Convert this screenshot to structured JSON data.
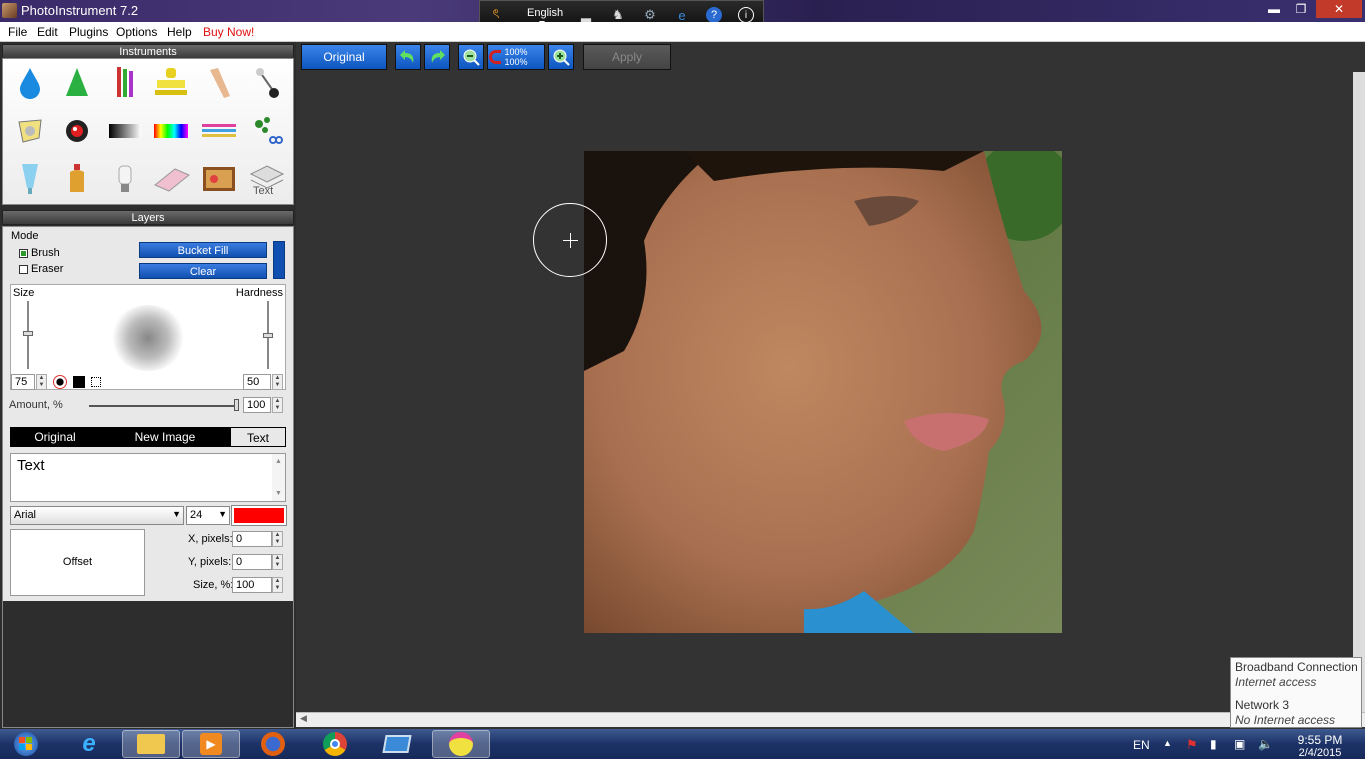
{
  "window": {
    "title": "PhotoInstrument 7.2"
  },
  "topstrip": {
    "language": "English"
  },
  "window_controls": {
    "minimize": "▬",
    "restore": "❐",
    "close": "✕"
  },
  "menu": {
    "file": "File",
    "edit": "Edit",
    "plugins": "Plugins",
    "options": "Options",
    "help": "Help",
    "buy": "Buy Now!"
  },
  "instruments": {
    "title": "Instruments"
  },
  "layers": {
    "title": "Layers",
    "mode_label": "Mode",
    "brush_label": "Brush",
    "eraser_label": "Eraser",
    "bucket_fill": "Bucket Fill",
    "clear": "Clear",
    "size_label": "Size",
    "hardness_label": "Hardness",
    "size_value": "75",
    "hardness_value": "50",
    "amount_label": "Amount, %",
    "amount_value": "100",
    "tabs": {
      "original": "Original",
      "new_image": "New Image",
      "text": "Text"
    },
    "text_value": "Text",
    "font_value": "Arial",
    "font_size_value": "24",
    "text_color": "#ff0000",
    "offset_label": "Offset",
    "x_label": "X, pixels:",
    "x_value": "0",
    "y_label": "Y, pixels:",
    "y_value": "0",
    "sizepct_label": "Size, %:",
    "sizepct_value": "100"
  },
  "toolbar": {
    "original": "Original",
    "zoom_100_top": "100%",
    "zoom_100_bottom": "100%",
    "apply": "Apply"
  },
  "tooltip": {
    "conn1_name": "Broadband Connection",
    "conn1_status": "Internet access",
    "conn2_name": "Network  3",
    "conn2_status": "No Internet access"
  },
  "tray": {
    "lang": "EN",
    "time": "9:55 PM",
    "date": "2/4/2015"
  }
}
